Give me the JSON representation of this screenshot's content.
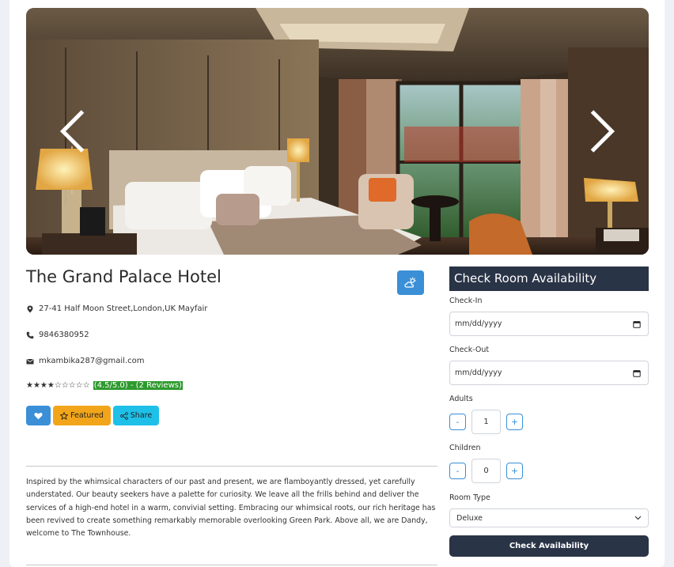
{
  "hotel": {
    "name": "The Grand Palace Hotel",
    "address": "27-41 Half Moon Street,London,UK Mayfair",
    "phone": "9846380952",
    "email": "mkambika287@gmail.com",
    "rating_stars": "★★★★☆☆☆☆☆",
    "rating_value": 4.5,
    "rating_text": "(4.5/5.0) - (2 Reviews)",
    "description": "Inspired by the whimsical characters of our past and present, we are flamboyantly dressed, yet carefully understated. Our beauty seekers have a palette for curiosity. We leave all the frills behind and deliver the services of a high-end hotel in a warm, convivial setting. Embracing our whimsical roots, our rich heritage has been revived to create something remarkably memorable overlooking Green Park. Above all, we are Dandy, welcome to The Townhouse."
  },
  "actions": {
    "featured_label": "Featured",
    "share_label": "Share"
  },
  "availability": {
    "title": "Check Room Availability",
    "checkin_label": "Check-In",
    "checkin_value": "mm/dd/yyyy",
    "checkout_label": "Check-Out",
    "checkout_value": "mm/dd/yyyy",
    "adults_label": "Adults",
    "adults_value": "1",
    "children_label": "Children",
    "children_value": "0",
    "minus_label": "-",
    "plus_label": "+",
    "room_type_label": "Room Type",
    "room_type_value": "Deluxe",
    "submit_label": "Check Availability"
  },
  "colors": {
    "primary_blue": "#3a8fd6",
    "featured_orange": "#f2a51a",
    "share_cyan": "#1ec0e8",
    "panel_dark": "#2a3447",
    "rating_green": "#2e9a2e"
  },
  "icons": {
    "weather": "cloud-sun-icon",
    "location": "map-marker-icon",
    "phone": "phone-icon",
    "email": "envelope-icon",
    "favorite": "heart-icon",
    "featured": "star-outline-icon",
    "share": "share-nodes-icon",
    "prev": "chevron-left-icon",
    "next": "chevron-right-icon",
    "calendar": "calendar-icon",
    "dropdown": "chevron-down-icon"
  }
}
